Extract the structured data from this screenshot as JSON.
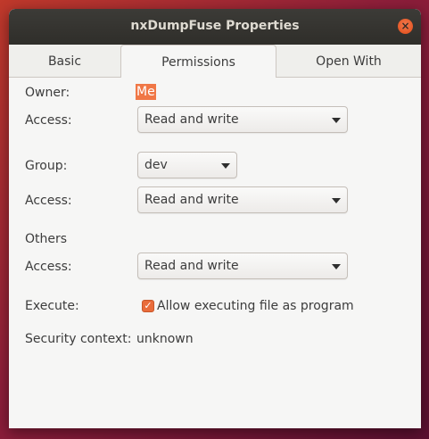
{
  "window": {
    "title": "nxDumpFuse Properties",
    "close_glyph": "×"
  },
  "tabs": [
    {
      "label": "Basic",
      "active": false
    },
    {
      "label": "Permissions",
      "active": true
    },
    {
      "label": "Open With",
      "active": false
    }
  ],
  "owner": {
    "label": "Owner:",
    "value": "Me"
  },
  "owner_access": {
    "label": "Access:",
    "value": "Read and write"
  },
  "group": {
    "label": "Group:",
    "value": "dev"
  },
  "group_access": {
    "label": "Access:",
    "value": "Read and write"
  },
  "others": {
    "heading": "Others"
  },
  "others_access": {
    "label": "Access:",
    "value": "Read and write"
  },
  "execute": {
    "label": "Execute:",
    "checkbox_label": "Allow executing file as program",
    "checked": true
  },
  "security": {
    "label": "Security context:",
    "value": "unknown"
  },
  "colors": {
    "accent": "#e96c3b",
    "titlebar": "#3c3b37",
    "close": "#df4a16",
    "background": "#f6f6f5"
  }
}
